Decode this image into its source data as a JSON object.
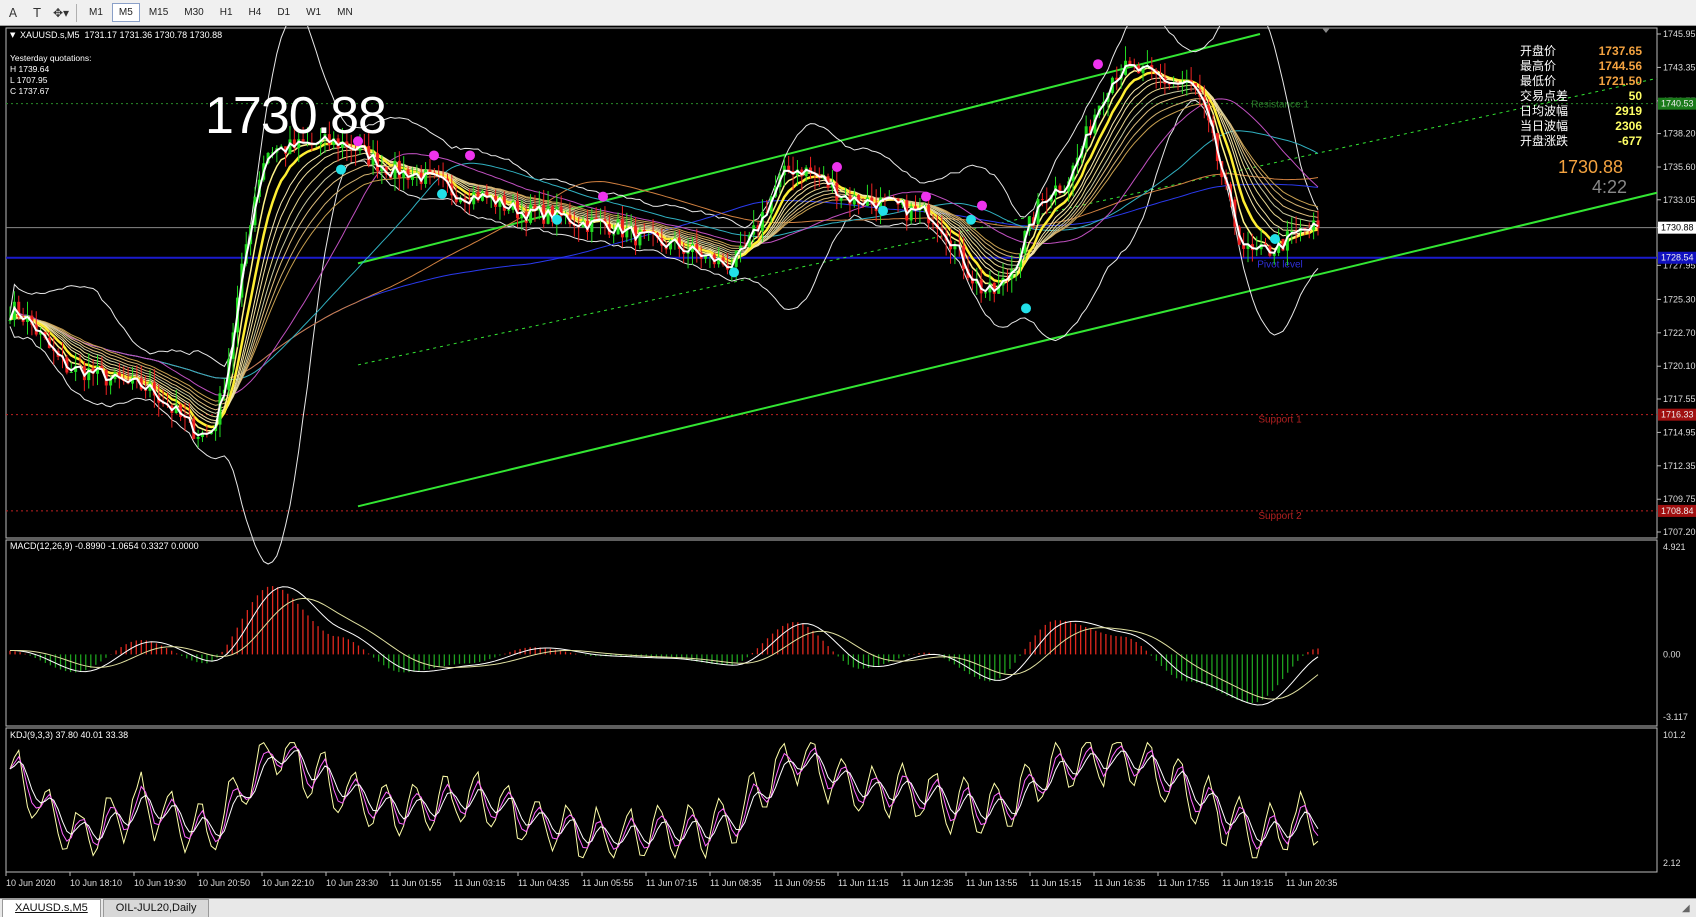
{
  "toolbar": {
    "icons": [
      "crosshair-icon",
      "text-icon",
      "shapes-icon"
    ],
    "timeframes": [
      "M1",
      "M5",
      "M15",
      "M30",
      "H1",
      "H4",
      "D1",
      "W1",
      "MN"
    ],
    "active_timeframe": "M5"
  },
  "main_chart": {
    "header": "XAUUSD.s,M5  1731.17 1731.36 1730.78 1730.88",
    "yesterday": {
      "title": "Yesterday quotations:",
      "high": "H 1739.64",
      "low": "L 1707.95",
      "close": "C 1737.67"
    },
    "big_price": "1730.88",
    "info_panel": [
      {
        "label": "开盘价",
        "value": "1737.65",
        "color": "#f4a340"
      },
      {
        "label": "最高价",
        "value": "1744.56",
        "color": "#f4a340"
      },
      {
        "label": "最低价",
        "value": "1721.50",
        "color": "#f4a340"
      },
      {
        "label": "交易点差",
        "value": "50",
        "color": "#ffff66"
      },
      {
        "label": "日均波幅",
        "value": "2919",
        "color": "#ffff66"
      },
      {
        "label": "当日波幅",
        "value": "2306",
        "color": "#ffff66"
      },
      {
        "label": "开盘涨跌",
        "value": "-677",
        "color": "#ffff66"
      }
    ],
    "current_price": "1730.88",
    "countdown": "4:22",
    "y_axis_labels": [
      "1745.95",
      "1743.35",
      "1740.75",
      "1738.20",
      "1735.60",
      "1733.05",
      "1730.88",
      "1727.95",
      "1725.30",
      "1722.70",
      "1720.10",
      "1717.55",
      "1714.95",
      "1712.35",
      "1709.75",
      "1707.20"
    ],
    "level_tags": {
      "resistance": "1740.53",
      "pivot": "1728.54",
      "support1": "1716.33",
      "support2": "1708.84"
    },
    "level_labels": {
      "resistance": "Resistance 1",
      "pivot": "Pivot level",
      "support1": "Support 1",
      "support2": "Support 2"
    }
  },
  "macd": {
    "header": "MACD(12,26,9) -0.8990 -1.0654 0.3327 0.0000",
    "y_labels": [
      "4.921",
      "0.00",
      "-3.117"
    ]
  },
  "kdj": {
    "header": "KDJ(9,3,3) 37.80 40.01 33.38",
    "y_labels": [
      "101.2",
      "2.12"
    ]
  },
  "x_axis_labels": [
    "10 Jun 2020",
    "10 Jun 18:10",
    "10 Jun 19:30",
    "10 Jun 20:50",
    "10 Jun 22:10",
    "10 Jun 23:30",
    "11 Jun 01:55",
    "11 Jun 03:15",
    "11 Jun 04:35",
    "11 Jun 05:55",
    "11 Jun 07:15",
    "11 Jun 08:35",
    "11 Jun 09:55",
    "11 Jun 11:15",
    "11 Jun 12:35",
    "11 Jun 13:55",
    "11 Jun 15:15",
    "11 Jun 16:35",
    "11 Jun 17:55",
    "11 Jun 19:15",
    "11 Jun 20:35"
  ],
  "tabs": [
    "XAUUSD.s,M5",
    "OIL-JUL20,Daily"
  ],
  "colors": {
    "channel": "#33e633",
    "bollinger": "#ffffff",
    "price_line": "#ffffff",
    "ema_gold": "#ffee33",
    "macd_up": "#e0281e",
    "macd_down": "#1ea01e",
    "pivot_blue": "#1a1acc",
    "support_red": "#c02020"
  },
  "chart_data": [
    {
      "type": "line",
      "title": "XAUUSD.s,M5",
      "ylim": [
        1707.2,
        1745.95
      ],
      "x": [
        "10 Jun 2020",
        "10 Jun 18:10",
        "10 Jun 19:30",
        "10 Jun 20:50",
        "10 Jun 22:10",
        "10 Jun 23:30",
        "11 Jun 01:55",
        "11 Jun 03:15",
        "11 Jun 04:35",
        "11 Jun 05:55",
        "11 Jun 07:15",
        "11 Jun 08:35",
        "11 Jun 09:55",
        "11 Jun 11:15",
        "11 Jun 12:35",
        "11 Jun 13:55",
        "11 Jun 15:15",
        "11 Jun 16:35",
        "11 Jun 17:55",
        "11 Jun 19:15",
        "11 Jun 20:35"
      ],
      "series": [
        {
          "values": [
            1724.5,
            1719.8,
            1718.5,
            1714.8,
            1737.0,
            1737.5,
            1735.2,
            1733.5,
            1732.0,
            1731.2,
            1729.6,
            1728.1,
            1735.5,
            1733.0,
            1732.0,
            1725.8,
            1734.0,
            1743.2,
            1742.0,
            1728.8,
            1730.88
          ]
        }
      ]
    },
    {
      "type": "bar",
      "title": "MACD(12,26,9)",
      "ylim": [
        -3.117,
        4.921
      ],
      "x": [
        "10 Jun 2020",
        "10 Jun 18:10",
        "10 Jun 19:30",
        "10 Jun 20:50",
        "10 Jun 22:10",
        "10 Jun 23:30",
        "11 Jun 01:55",
        "11 Jun 03:15",
        "11 Jun 04:35",
        "11 Jun 05:55",
        "11 Jun 07:15",
        "11 Jun 08:35",
        "11 Jun 09:55",
        "11 Jun 11:15",
        "11 Jun 12:35",
        "11 Jun 13:55",
        "11 Jun 15:15",
        "11 Jun 16:35",
        "11 Jun 17:55",
        "11 Jun 19:15",
        "11 Jun 20:35"
      ],
      "values": [
        0.2,
        -1.0,
        0.8,
        -0.5,
        3.8,
        1.0,
        -1.0,
        -0.5,
        0.4,
        -0.1,
        -0.2,
        -0.6,
        1.8,
        -0.8,
        0.1,
        -1.5,
        1.9,
        1.0,
        -1.5,
        -2.7,
        0.33
      ]
    },
    {
      "type": "line",
      "title": "KDJ(9,3,3)",
      "ylim": [
        2.12,
        101.2
      ],
      "x": [
        "10 Jun 2020",
        "10 Jun 18:10",
        "10 Jun 19:30",
        "10 Jun 20:50",
        "10 Jun 22:10",
        "10 Jun 23:30",
        "11 Jun 01:55",
        "11 Jun 03:15",
        "11 Jun 04:35",
        "11 Jun 05:55",
        "11 Jun 07:15",
        "11 Jun 08:35",
        "11 Jun 09:55",
        "11 Jun 11:15",
        "11 Jun 12:35",
        "11 Jun 13:55",
        "11 Jun 15:15",
        "11 Jun 16:35",
        "11 Jun 17:55",
        "11 Jun 19:15",
        "11 Jun 20:35"
      ],
      "series": [
        {
          "values": [
            75,
            20,
            50,
            22,
            95,
            60,
            40,
            55,
            35,
            20,
            25,
            30,
            90,
            60,
            55,
            40,
            80,
            90,
            60,
            20,
            37.8
          ]
        }
      ]
    }
  ]
}
